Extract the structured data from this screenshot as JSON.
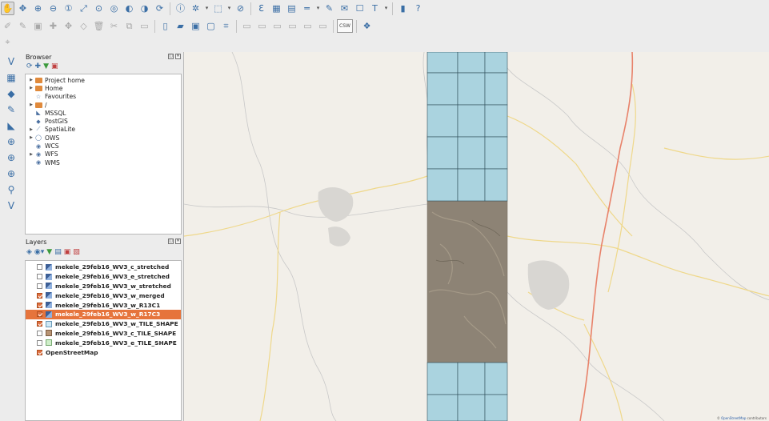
{
  "toolbar_row1": {
    "icons": [
      "pan-hand-icon",
      "pan-to-selection-icon",
      "zoom-in-icon",
      "zoom-out-icon",
      "zoom-native-icon",
      "zoom-full-icon",
      "zoom-to-selection-icon",
      "zoom-to-layer-icon",
      "zoom-last-icon",
      "zoom-next-icon",
      "refresh-icon",
      "identify-icon",
      "measure-icon",
      "select-features-icon",
      "deselect-icon",
      "field-calculator-icon",
      "attribute-table-icon",
      "statistics-icon",
      "measure-line-icon",
      "annotation-icon",
      "text-annotation-icon",
      "map-tips-icon",
      "label-icon",
      "help-book-icon",
      "whats-this-icon"
    ]
  },
  "toolbar_row2": {
    "icons": [
      "current-edits-icon",
      "toggle-editing-icon",
      "save-edits-icon",
      "add-feature-icon",
      "move-feature-icon",
      "node-tool-icon",
      "delete-selected-icon",
      "cut-features-icon",
      "copy-features-icon",
      "paste-features-icon",
      "new-project-icon",
      "open-project-icon",
      "save-project-icon",
      "save-as-icon",
      "new-print-composer-icon",
      "label-tool-1-icon",
      "label-tool-2-icon",
      "label-tool-3-icon",
      "label-tool-4-icon",
      "label-tool-5-icon",
      "label-tool-6-icon",
      "csw-icon",
      "python-console-icon"
    ],
    "csw_label": "CSW"
  },
  "left_toolbar": {
    "icons": [
      "add-vector-layer-icon",
      "add-raster-layer-icon",
      "add-postgis-layer-icon",
      "add-spatialite-layer-icon",
      "add-mssql-layer-icon",
      "add-wms-layer-icon",
      "add-wcs-layer-icon",
      "add-wfs-layer-icon",
      "add-delimited-text-icon",
      "new-shapefile-icon"
    ]
  },
  "browser": {
    "title": "Browser",
    "items": [
      {
        "label": "Project home",
        "icon": "folder-icon",
        "expandable": true
      },
      {
        "label": "Home",
        "icon": "folder-icon",
        "expandable": true
      },
      {
        "label": "Favourites",
        "icon": "star-icon",
        "expandable": false
      },
      {
        "label": "/",
        "icon": "folder-icon",
        "expandable": true
      },
      {
        "label": "MSSQL",
        "icon": "mssql-icon",
        "expandable": false
      },
      {
        "label": "PostGIS",
        "icon": "postgis-icon",
        "expandable": false
      },
      {
        "label": "SpatiaLite",
        "icon": "spatialite-icon",
        "expandable": true
      },
      {
        "label": "OWS",
        "icon": "ows-icon",
        "expandable": true
      },
      {
        "label": "WCS",
        "icon": "wcs-icon",
        "expandable": false
      },
      {
        "label": "WFS",
        "icon": "wfs-icon",
        "expandable": true
      },
      {
        "label": "WMS",
        "icon": "wms-icon",
        "expandable": false
      }
    ]
  },
  "layers": {
    "title": "Layers",
    "items": [
      {
        "label": "mekele_29feb16_WV3_c_stretched",
        "checked": false,
        "symbol": "raster"
      },
      {
        "label": "mekele_29feb16_WV3_e_stretched",
        "checked": false,
        "symbol": "raster"
      },
      {
        "label": "mekele_29feb16_WV3_w_stretched",
        "checked": false,
        "symbol": "raster"
      },
      {
        "label": "mekele_29feb16_WV3_w_merged",
        "checked": true,
        "symbol": "raster"
      },
      {
        "label": "mekele_29feb16_WV3_w_R13C1",
        "checked": true,
        "symbol": "raster"
      },
      {
        "label": "mekele_29feb16_WV3_w_R17C3",
        "checked": true,
        "symbol": "raster",
        "selected": true
      },
      {
        "label": "mekele_29feb16_WV3_w_TILE_SHAPE",
        "checked": true,
        "symbol": "fill-blue"
      },
      {
        "label": "mekele_29feb16_WV3_c_TILE_SHAPE",
        "checked": false,
        "symbol": "fill-brown"
      },
      {
        "label": "mekele_29feb16_WV3_e_TILE_SHAPE",
        "checked": false,
        "symbol": "fill-green"
      },
      {
        "label": "OpenStreetMap",
        "checked": true,
        "symbol": "none"
      }
    ]
  },
  "map": {
    "attribution_prefix": "©",
    "attribution_link": "OpenStreetMap",
    "attribution_suffix": "contributors",
    "colors": {
      "background": "#f2efe9",
      "tile_fill": "#aad3df",
      "tile_stroke": "#2f4f5a",
      "road_primary": "#e8826a",
      "road_secondary": "#f3e3a6",
      "boundary": "#b8b8b8",
      "urban": "#d6d4d0",
      "imagery": "#8d8375",
      "selected_layer": "#e6743c"
    }
  }
}
